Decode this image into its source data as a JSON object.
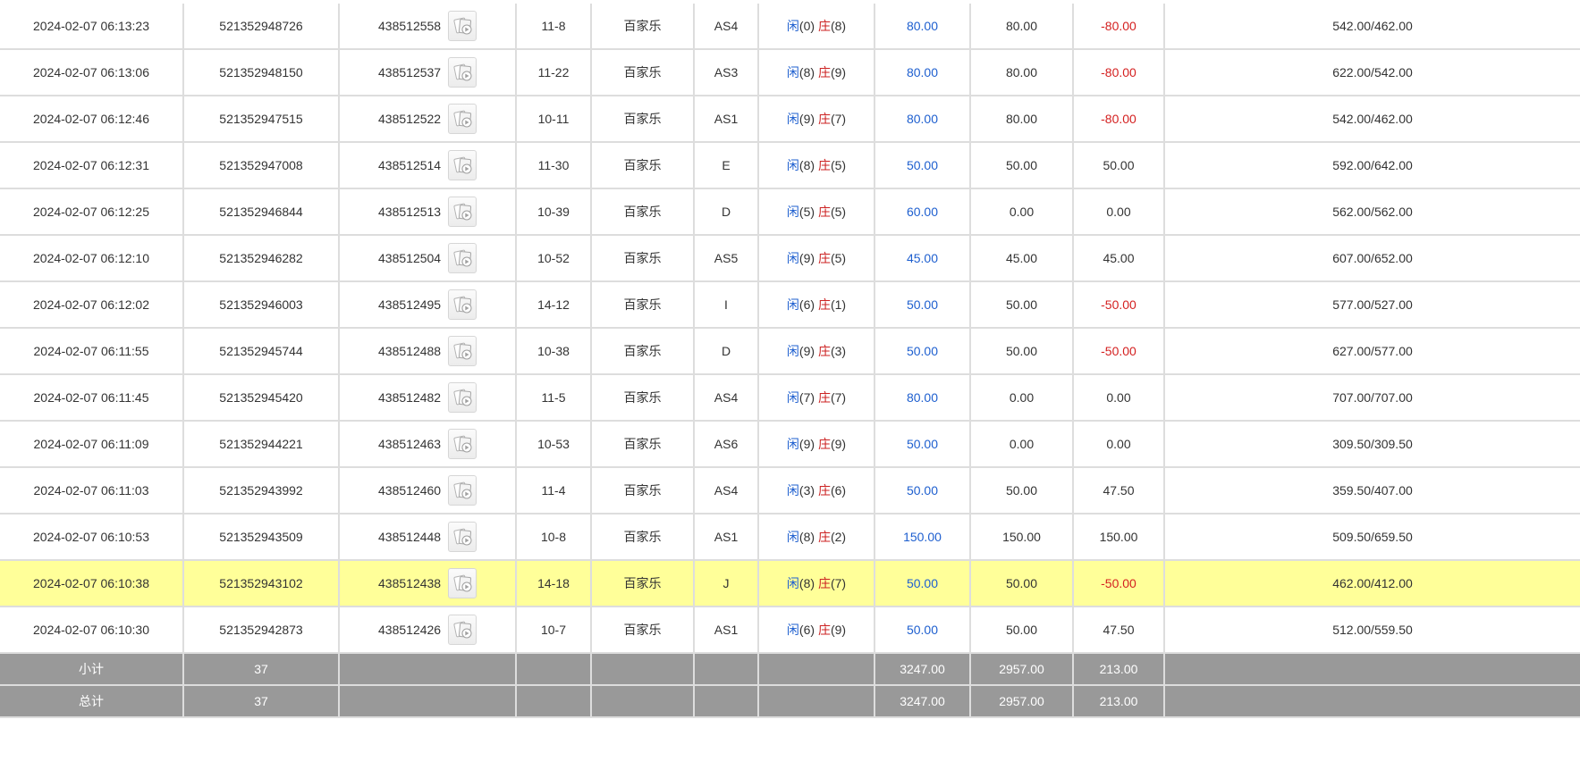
{
  "colors": {
    "player": "#1e5fcf",
    "banker": "#cc2222",
    "negative": "#d42020",
    "highlight_row": "#ffff99",
    "summary_row": "#999999"
  },
  "replay_icon": "card-replay-icon",
  "rows": [
    {
      "time": "2024-02-07 06:13:23",
      "bet_id": "521352948726",
      "round_id": "438512558",
      "shoe": "11-8",
      "game": "百家乐",
      "table": "AS4",
      "r_p_label": "闲",
      "r_p_val": "(0)",
      "r_b_label": "庄",
      "r_b_val": "(8)",
      "bet": "80.00",
      "valid": "80.00",
      "win": "-80.00",
      "win_neg": true,
      "balance": "542.00/462.00",
      "hl": false
    },
    {
      "time": "2024-02-07 06:13:06",
      "bet_id": "521352948150",
      "round_id": "438512537",
      "shoe": "11-22",
      "game": "百家乐",
      "table": "AS3",
      "r_p_label": "闲",
      "r_p_val": "(8)",
      "r_b_label": "庄",
      "r_b_val": "(9)",
      "bet": "80.00",
      "valid": "80.00",
      "win": "-80.00",
      "win_neg": true,
      "balance": "622.00/542.00",
      "hl": false
    },
    {
      "time": "2024-02-07 06:12:46",
      "bet_id": "521352947515",
      "round_id": "438512522",
      "shoe": "10-11",
      "game": "百家乐",
      "table": "AS1",
      "r_p_label": "闲",
      "r_p_val": "(9)",
      "r_b_label": "庄",
      "r_b_val": "(7)",
      "bet": "80.00",
      "valid": "80.00",
      "win": "-80.00",
      "win_neg": true,
      "balance": "542.00/462.00",
      "hl": false
    },
    {
      "time": "2024-02-07 06:12:31",
      "bet_id": "521352947008",
      "round_id": "438512514",
      "shoe": "11-30",
      "game": "百家乐",
      "table": "E",
      "r_p_label": "闲",
      "r_p_val": "(8)",
      "r_b_label": "庄",
      "r_b_val": "(5)",
      "bet": "50.00",
      "valid": "50.00",
      "win": "50.00",
      "win_neg": false,
      "balance": "592.00/642.00",
      "hl": false
    },
    {
      "time": "2024-02-07 06:12:25",
      "bet_id": "521352946844",
      "round_id": "438512513",
      "shoe": "10-39",
      "game": "百家乐",
      "table": "D",
      "r_p_label": "闲",
      "r_p_val": "(5)",
      "r_b_label": "庄",
      "r_b_val": "(5)",
      "bet": "60.00",
      "valid": "0.00",
      "win": "0.00",
      "win_neg": false,
      "balance": "562.00/562.00",
      "hl": false
    },
    {
      "time": "2024-02-07 06:12:10",
      "bet_id": "521352946282",
      "round_id": "438512504",
      "shoe": "10-52",
      "game": "百家乐",
      "table": "AS5",
      "r_p_label": "闲",
      "r_p_val": "(9)",
      "r_b_label": "庄",
      "r_b_val": "(5)",
      "bet": "45.00",
      "valid": "45.00",
      "win": "45.00",
      "win_neg": false,
      "balance": "607.00/652.00",
      "hl": false
    },
    {
      "time": "2024-02-07 06:12:02",
      "bet_id": "521352946003",
      "round_id": "438512495",
      "shoe": "14-12",
      "game": "百家乐",
      "table": "I",
      "r_p_label": "闲",
      "r_p_val": "(6)",
      "r_b_label": "庄",
      "r_b_val": "(1)",
      "bet": "50.00",
      "valid": "50.00",
      "win": "-50.00",
      "win_neg": true,
      "balance": "577.00/527.00",
      "hl": false
    },
    {
      "time": "2024-02-07 06:11:55",
      "bet_id": "521352945744",
      "round_id": "438512488",
      "shoe": "10-38",
      "game": "百家乐",
      "table": "D",
      "r_p_label": "闲",
      "r_p_val": "(9)",
      "r_b_label": "庄",
      "r_b_val": "(3)",
      "bet": "50.00",
      "valid": "50.00",
      "win": "-50.00",
      "win_neg": true,
      "balance": "627.00/577.00",
      "hl": false
    },
    {
      "time": "2024-02-07 06:11:45",
      "bet_id": "521352945420",
      "round_id": "438512482",
      "shoe": "11-5",
      "game": "百家乐",
      "table": "AS4",
      "r_p_label": "闲",
      "r_p_val": "(7)",
      "r_b_label": "庄",
      "r_b_val": "(7)",
      "bet": "80.00",
      "valid": "0.00",
      "win": "0.00",
      "win_neg": false,
      "balance": "707.00/707.00",
      "hl": false
    },
    {
      "time": "2024-02-07 06:11:09",
      "bet_id": "521352944221",
      "round_id": "438512463",
      "shoe": "10-53",
      "game": "百家乐",
      "table": "AS6",
      "r_p_label": "闲",
      "r_p_val": "(9)",
      "r_b_label": "庄",
      "r_b_val": "(9)",
      "bet": "50.00",
      "valid": "0.00",
      "win": "0.00",
      "win_neg": false,
      "balance": "309.50/309.50",
      "hl": false
    },
    {
      "time": "2024-02-07 06:11:03",
      "bet_id": "521352943992",
      "round_id": "438512460",
      "shoe": "11-4",
      "game": "百家乐",
      "table": "AS4",
      "r_p_label": "闲",
      "r_p_val": "(3)",
      "r_b_label": "庄",
      "r_b_val": "(6)",
      "bet": "50.00",
      "valid": "50.00",
      "win": "47.50",
      "win_neg": false,
      "balance": "359.50/407.00",
      "hl": false
    },
    {
      "time": "2024-02-07 06:10:53",
      "bet_id": "521352943509",
      "round_id": "438512448",
      "shoe": "10-8",
      "game": "百家乐",
      "table": "AS1",
      "r_p_label": "闲",
      "r_p_val": "(8)",
      "r_b_label": "庄",
      "r_b_val": "(2)",
      "bet": "150.00",
      "valid": "150.00",
      "win": "150.00",
      "win_neg": false,
      "balance": "509.50/659.50",
      "hl": false
    },
    {
      "time": "2024-02-07 06:10:38",
      "bet_id": "521352943102",
      "round_id": "438512438",
      "shoe": "14-18",
      "game": "百家乐",
      "table": "J",
      "r_p_label": "闲",
      "r_p_val": "(8)",
      "r_b_label": "庄",
      "r_b_val": "(7)",
      "bet": "50.00",
      "valid": "50.00",
      "win": "-50.00",
      "win_neg": true,
      "balance": "462.00/412.00",
      "hl": true
    },
    {
      "time": "2024-02-07 06:10:30",
      "bet_id": "521352942873",
      "round_id": "438512426",
      "shoe": "10-7",
      "game": "百家乐",
      "table": "AS1",
      "r_p_label": "闲",
      "r_p_val": "(6)",
      "r_b_label": "庄",
      "r_b_val": "(9)",
      "bet": "50.00",
      "valid": "50.00",
      "win": "47.50",
      "win_neg": false,
      "balance": "512.00/559.50",
      "hl": false
    }
  ],
  "subtotal": {
    "label": "小计",
    "count": "37",
    "bet": "3247.00",
    "valid": "2957.00",
    "win": "213.00"
  },
  "total": {
    "label": "总计",
    "count": "37",
    "bet": "3247.00",
    "valid": "2957.00",
    "win": "213.00"
  }
}
